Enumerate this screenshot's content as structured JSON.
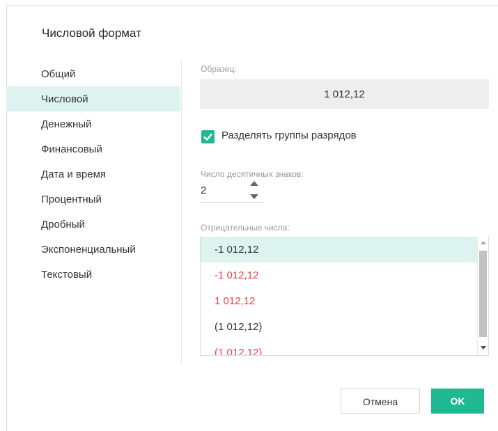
{
  "dialog": {
    "title": "Числовой формат"
  },
  "categories": [
    {
      "label": "Общий",
      "active": false
    },
    {
      "label": "Числовой",
      "active": true
    },
    {
      "label": "Денежный",
      "active": false
    },
    {
      "label": "Финансовый",
      "active": false
    },
    {
      "label": "Дата и время",
      "active": false
    },
    {
      "label": "Процентный",
      "active": false
    },
    {
      "label": "Дробный",
      "active": false
    },
    {
      "label": "Экспоненциальный",
      "active": false
    },
    {
      "label": "Текстовый",
      "active": false
    }
  ],
  "sample": {
    "label": "Образец:",
    "value": "1 012,12"
  },
  "separator": {
    "label": "Разделять группы разрядов",
    "checked": true
  },
  "decimals": {
    "label": "Число десятичных знаков:",
    "value": "2"
  },
  "negative": {
    "label": "Отрицательные числа:",
    "options": [
      {
        "text": "-1 012,12",
        "color": "#333333",
        "selected": true
      },
      {
        "text": "-1 012,12",
        "color": "#e8434c",
        "selected": false
      },
      {
        "text": "1 012,12",
        "color": "#e8434c",
        "selected": false
      },
      {
        "text": "(1 012,12)",
        "color": "#333333",
        "selected": false
      },
      {
        "text": "(1 012,12)",
        "color": "#e8434c",
        "selected": false
      }
    ]
  },
  "buttons": {
    "cancel": "Отмена",
    "ok": "OK"
  },
  "colors": {
    "accent": "#20b893",
    "selection_bg": "#dcf3ef",
    "negative_red": "#e8434c"
  }
}
